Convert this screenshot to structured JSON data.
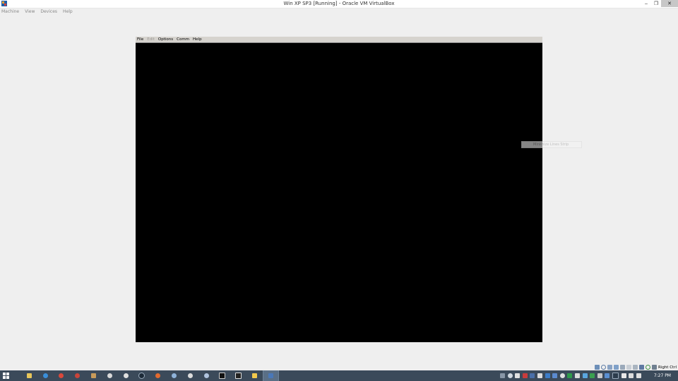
{
  "window": {
    "title": "Win XP SP3 [Running] - Oracle VM VirtualBox",
    "controls": {
      "minimize": "‒",
      "restore": "❐",
      "close": "✕"
    }
  },
  "vbox_menu": [
    "Machine",
    "View",
    "Devices",
    "Help"
  ],
  "guest": {
    "menu": [
      {
        "label": "File",
        "disabled": false
      },
      {
        "label": "Edit",
        "disabled": true
      },
      {
        "label": "Options",
        "disabled": false
      },
      {
        "label": "Comm",
        "disabled": false
      },
      {
        "label": "Help",
        "disabled": false
      }
    ],
    "tooltip": "Minimize Lines Strip"
  },
  "statusbar": {
    "icons": [
      "hard-disk-icon",
      "optical-drive-icon",
      "audio-icon",
      "network-icon",
      "usb-icon",
      "shared-folders-icon",
      "display-icon",
      "video-capture-icon",
      "mouse-integration-icon",
      "keyboard-icon"
    ],
    "host_key": "Right Ctrl"
  },
  "taskbar": {
    "apps": [
      "file-explorer-icon",
      "ie-icon",
      "chrome-icon",
      "tool-icon",
      "app-icon",
      "app-icon",
      "steam-icon",
      "circle-app-icon",
      "firefox-icon",
      "app-icon",
      "app-icon",
      "app-icon",
      "console-icon",
      "terminal-icon",
      "folder-icon",
      "virtualbox-icon"
    ],
    "active_index": 15,
    "tray": [
      "keyboard-icon",
      "skype-icon",
      "app-icon",
      "app-icon",
      "app-icon",
      "app-icon",
      "app-icon",
      "app-icon",
      "app-icon",
      "app-icon",
      "app-icon",
      "app-icon",
      "app-icon",
      "app-icon",
      "app-icon",
      "app-icon",
      "flag-icon",
      "network-icon",
      "volume-icon"
    ],
    "clock": "7:27 PM"
  },
  "colors": {
    "taskbar": "#3b4a5a",
    "guest_screen": "#000000",
    "desktop": "#efefef"
  }
}
